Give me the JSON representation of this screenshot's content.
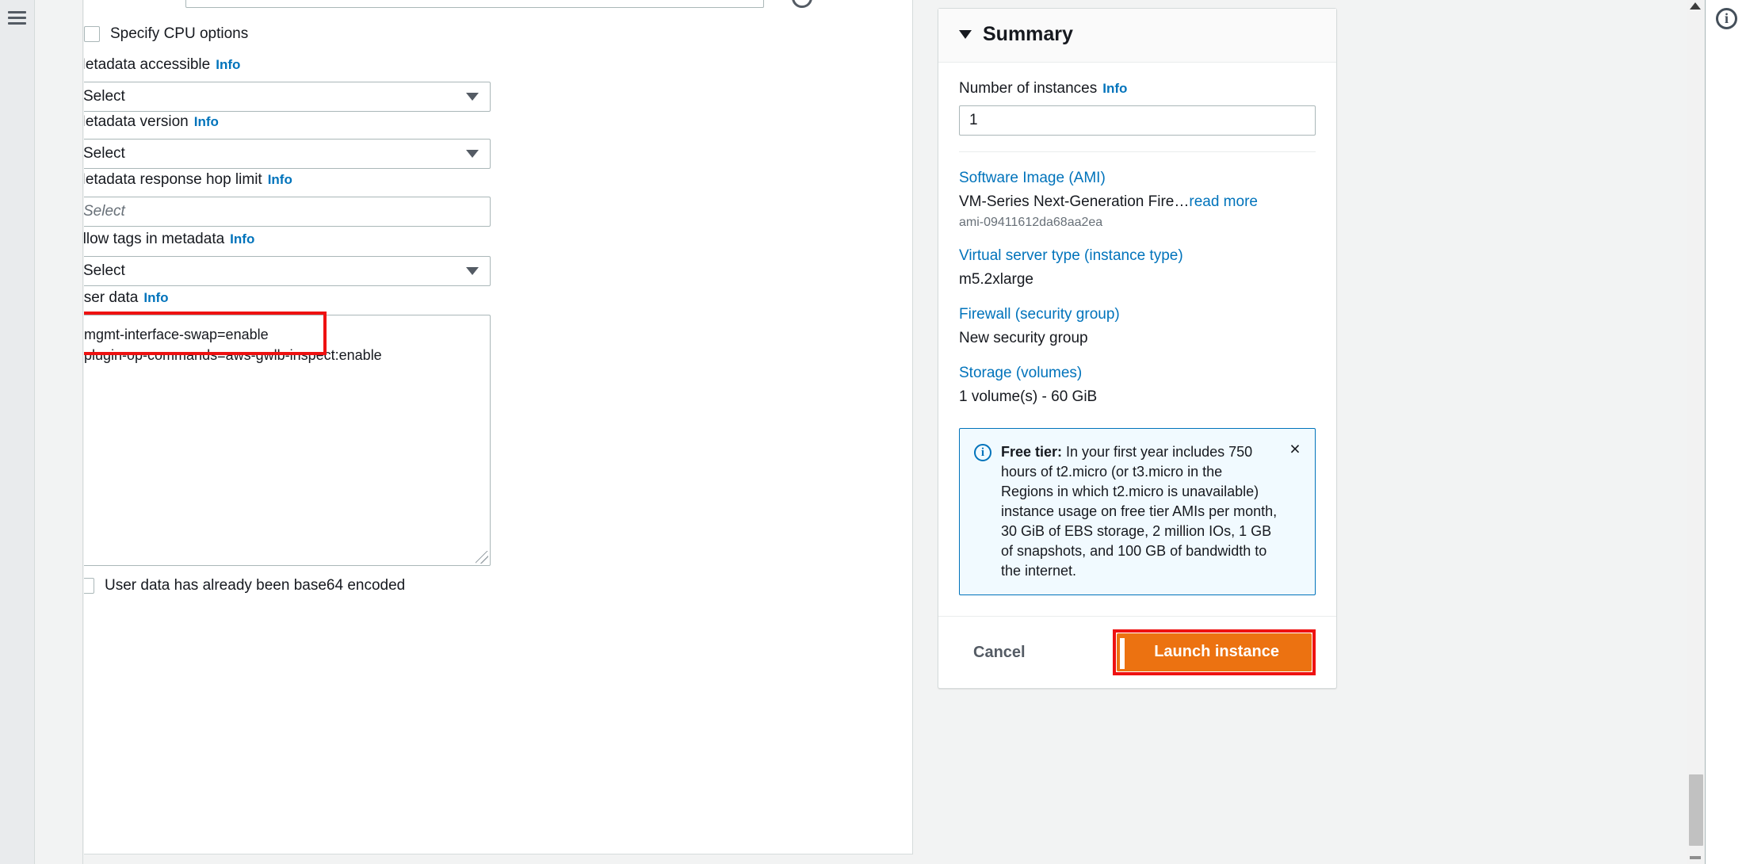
{
  "rail": {
    "menu_icon": "hamburger-icon"
  },
  "form": {
    "cpu_options": {
      "label": "Specify CPU options",
      "checked": false
    },
    "fields": [
      {
        "label": "Metadata accessible",
        "info": "Info",
        "value": "Select",
        "placeholder": false
      },
      {
        "label": "Metadata version",
        "info": "Info",
        "value": "Select",
        "placeholder": false
      },
      {
        "label": "Metadata response hop limit",
        "info": "Info",
        "value": "Select",
        "placeholder": true
      },
      {
        "label": "Allow tags in metadata",
        "info": "Info",
        "value": "Select",
        "placeholder": false
      }
    ],
    "user_data": {
      "label": "User data",
      "info": "Info",
      "value": "mgmt-interface-swap=enable\nplugin-op-commands=aws-gwlb-inspect:enable"
    },
    "base64_checkbox": {
      "label": "User data has already been base64 encoded",
      "checked": false
    }
  },
  "summary": {
    "title": "Summary",
    "collapse_icon": "triangle-down-icon",
    "instances": {
      "label": "Number of instances",
      "info": "Info",
      "value": "1"
    },
    "items": [
      {
        "link": "Software Image (AMI)",
        "value": "VM-Series Next-Generation Fire…",
        "read_more": "read more",
        "sub": "ami-09411612da68aa2ea"
      },
      {
        "link": "Virtual server type (instance type)",
        "value": "m5.2xlarge",
        "read_more": "",
        "sub": ""
      },
      {
        "link": "Firewall (security group)",
        "value": "New security group",
        "read_more": "",
        "sub": ""
      },
      {
        "link": "Storage (volumes)",
        "value": "1 volume(s) - 60 GiB",
        "read_more": "",
        "sub": ""
      }
    ],
    "free_tier": {
      "icon": "info-circle-icon",
      "bold_prefix": "Free tier:",
      "body": " In your first year includes 750 hours of t2.micro (or t3.micro in the Regions in which t2.micro is unavailable) instance usage on free tier AMIs per month, 30 GiB of EBS storage, 2 million IOs, 1 GB of snapshots, and 100 GB of bandwidth to the internet.",
      "close_icon": "×"
    },
    "cancel_label": "Cancel",
    "launch_label": "Launch instance"
  },
  "right": {
    "info_badge": "i"
  },
  "colors": {
    "accent_link": "#0073bb",
    "launch_orange": "#ec7211",
    "highlight_red": "#ee1111",
    "alert_bg": "#f1faff"
  }
}
